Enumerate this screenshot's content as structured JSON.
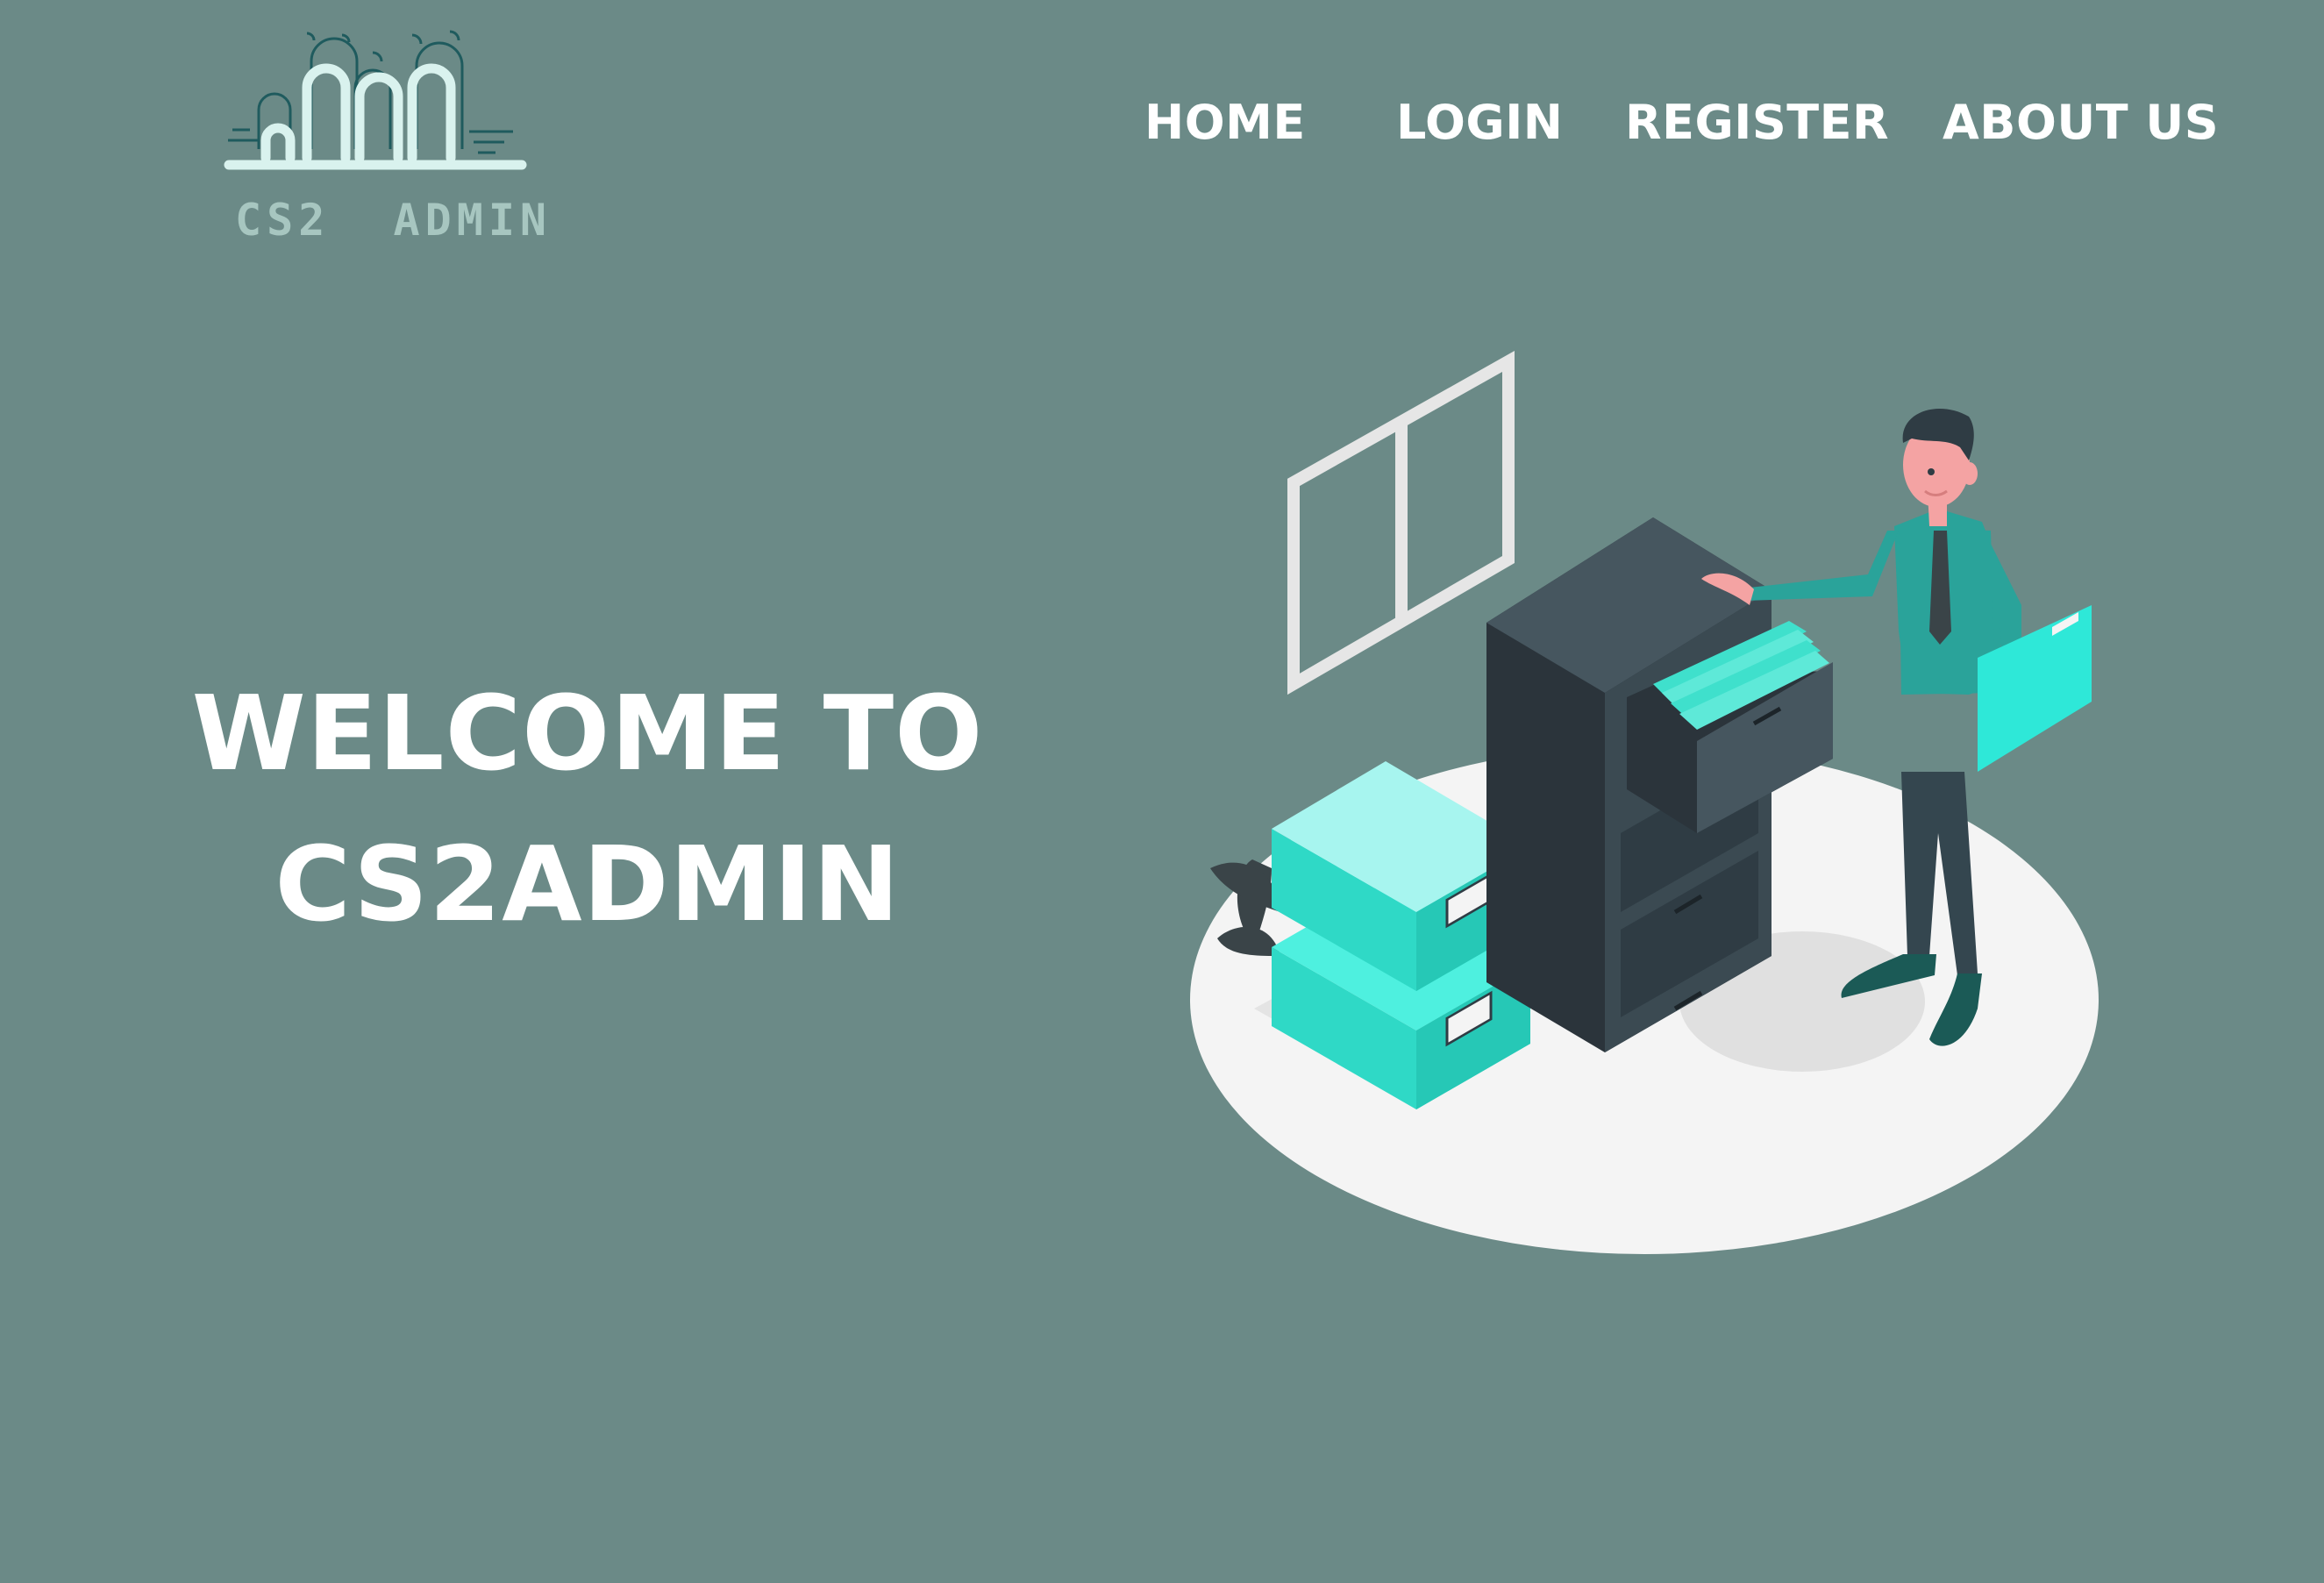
{
  "brand": {
    "name": "CS2  ADMIN"
  },
  "nav": {
    "items": [
      {
        "label": "HOME"
      },
      {
        "label": "LOGIN"
      },
      {
        "label": "REGISTER"
      },
      {
        "label": "ABOUT US"
      }
    ]
  },
  "hero": {
    "line1": "WELCOME TO",
    "line2": "CS2ADMIN"
  },
  "colors": {
    "background": "#6b8a87",
    "accent_teal": "#2ee8d8",
    "logo_text": "#a7c6c0",
    "cabinet_dark": "#2f3c44"
  },
  "icons": {
    "logo": "cs2-admin-logo",
    "illustration": "person-filing-cabinet-illustration"
  }
}
